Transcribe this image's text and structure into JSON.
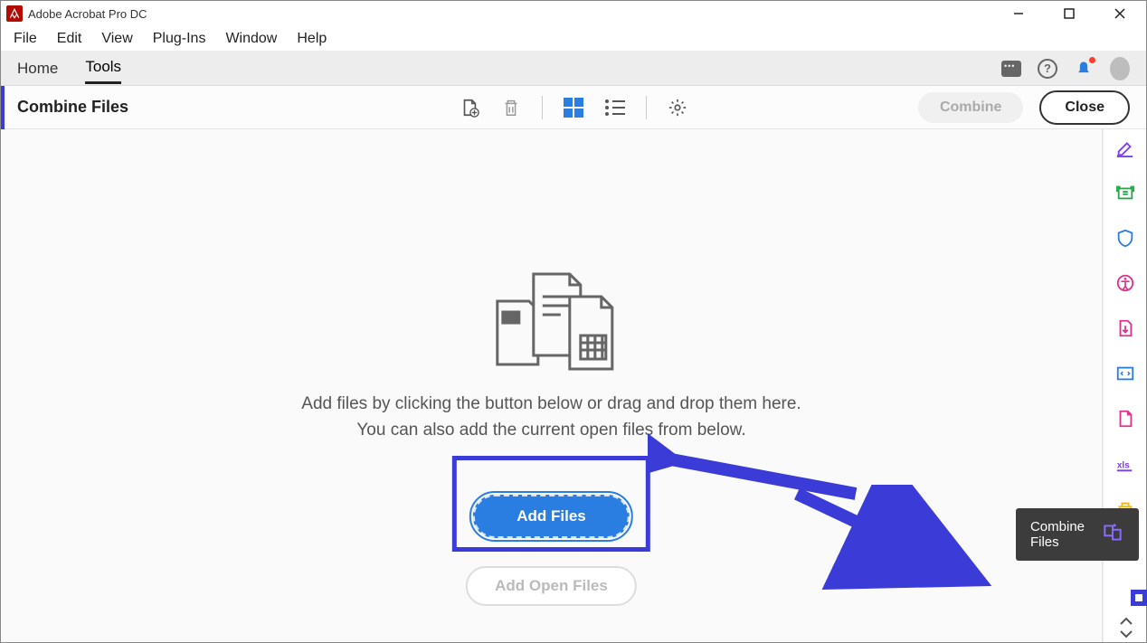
{
  "app": {
    "title": "Adobe Acrobat Pro DC"
  },
  "menu": {
    "file": "File",
    "edit": "Edit",
    "view": "View",
    "plugins": "Plug-Ins",
    "window": "Window",
    "help": "Help"
  },
  "tabs": {
    "home": "Home",
    "tools": "Tools"
  },
  "topright": {
    "chat_icon": "chat-icon",
    "help_icon": "help-icon",
    "bell_icon": "bell-icon",
    "avatar_icon": "avatar-icon"
  },
  "toolheader": {
    "title": "Combine Files",
    "addfile_icon": "add-file-icon",
    "trash_icon": "trash-icon",
    "grid_icon": "grid-view-icon",
    "list_icon": "list-view-icon",
    "gear_icon": "gear-icon",
    "combine_label": "Combine",
    "close_label": "Close"
  },
  "main": {
    "instr_line1": "Add files by clicking the button below or drag and drop them here.",
    "instr_line2": "You can also add the current open files from below.",
    "add_files_label": "Add Files",
    "add_open_files_label": "Add Open Files"
  },
  "tooltip": {
    "label": "Combine Files"
  },
  "rightpanel": {
    "items": [
      {
        "name": "edit-icon",
        "color": "#7b3ff2"
      },
      {
        "name": "export-icon",
        "color": "#2aa64a"
      },
      {
        "name": "protect-icon",
        "color": "#2a7de1"
      },
      {
        "name": "accessibility-icon",
        "color": "#e0318e"
      },
      {
        "name": "organize-icon",
        "color": "#e0318e"
      },
      {
        "name": "code-icon",
        "color": "#2a7de1"
      },
      {
        "name": "page-icon",
        "color": "#e0318e"
      },
      {
        "name": "xls-icon",
        "color": "#7b3ff2"
      },
      {
        "name": "crop-icon",
        "color": "#f2b90f"
      }
    ]
  }
}
